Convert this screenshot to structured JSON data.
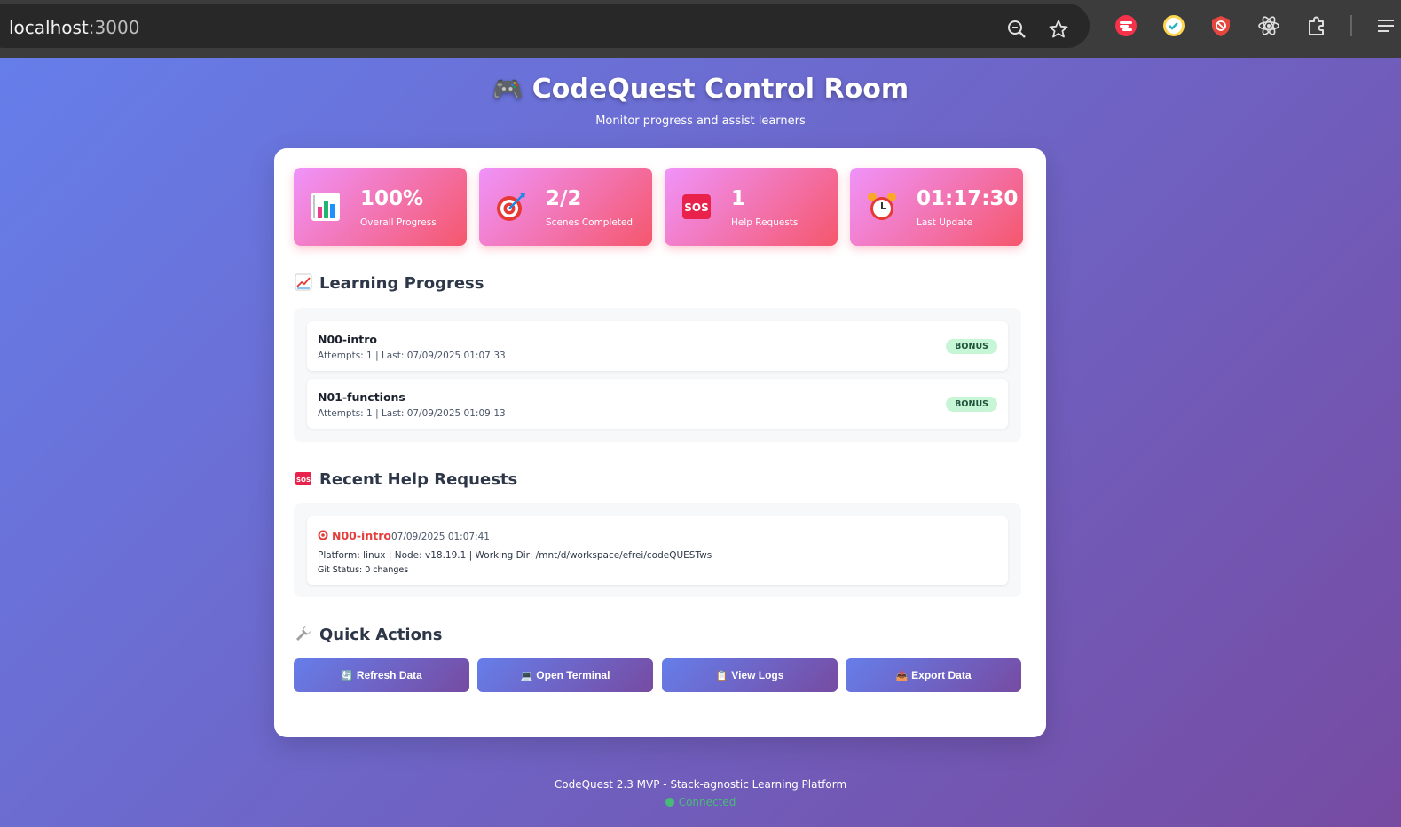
{
  "browser": {
    "url_host": "localhost",
    "url_port": ":3000",
    "toolbar_icons": [
      "zoom-icon",
      "bookmark-star-icon",
      "extension-red-icon",
      "extension-clock-icon",
      "extension-shield-icon",
      "react-devtools-icon",
      "extensions-puzzle-icon",
      "menu-icon"
    ]
  },
  "header": {
    "title": "CodeQuest Control Room",
    "title_emoji": "🎮",
    "subtitle": "Monitor progress and assist learners"
  },
  "stats": [
    {
      "icon": "bar-chart-icon",
      "value": "100%",
      "label": "Overall Progress"
    },
    {
      "icon": "target-icon",
      "value": "2/2",
      "label": "Scenes Completed"
    },
    {
      "icon": "sos-icon",
      "value": "1",
      "label": "Help Requests"
    },
    {
      "icon": "alarm-clock-icon",
      "value": "01:17:30",
      "label": "Last Update"
    }
  ],
  "learning": {
    "title": "Learning Progress",
    "items": [
      {
        "name": "N00-intro",
        "meta": "Attempts: 1 | Last: 07/09/2025 01:07:33",
        "badge": "BONUS"
      },
      {
        "name": "N01-functions",
        "meta": "Attempts: 1 | Last: 07/09/2025 01:09:13",
        "badge": "BONUS"
      }
    ]
  },
  "help": {
    "title": "Recent Help Requests",
    "items": [
      {
        "scene": "N00-intro",
        "time": "07/09/2025 01:07:41",
        "details": "Platform: linux | Node: v18.19.1 | Working Dir: /mnt/d/workspace/efrei/codeQUESTws",
        "git": "Git Status: 0 changes"
      }
    ]
  },
  "actions": {
    "title": "Quick Actions",
    "buttons": [
      {
        "icon": "🔄",
        "label": "Refresh Data"
      },
      {
        "icon": "💻",
        "label": "Open Terminal"
      },
      {
        "icon": "📋",
        "label": "View Logs"
      },
      {
        "icon": "📤",
        "label": "Export Data"
      }
    ]
  },
  "footer": {
    "text": "CodeQuest 2.3 MVP - Stack-agnostic Learning Platform",
    "status": "Connected"
  },
  "colors": {
    "bg_gradient_start": "#667eea",
    "bg_gradient_end": "#764ba2",
    "stat_gradient_start": "#f093fb",
    "stat_gradient_end": "#f5576c",
    "badge_bg": "#c6f6d5",
    "connected": "#48bb78"
  }
}
